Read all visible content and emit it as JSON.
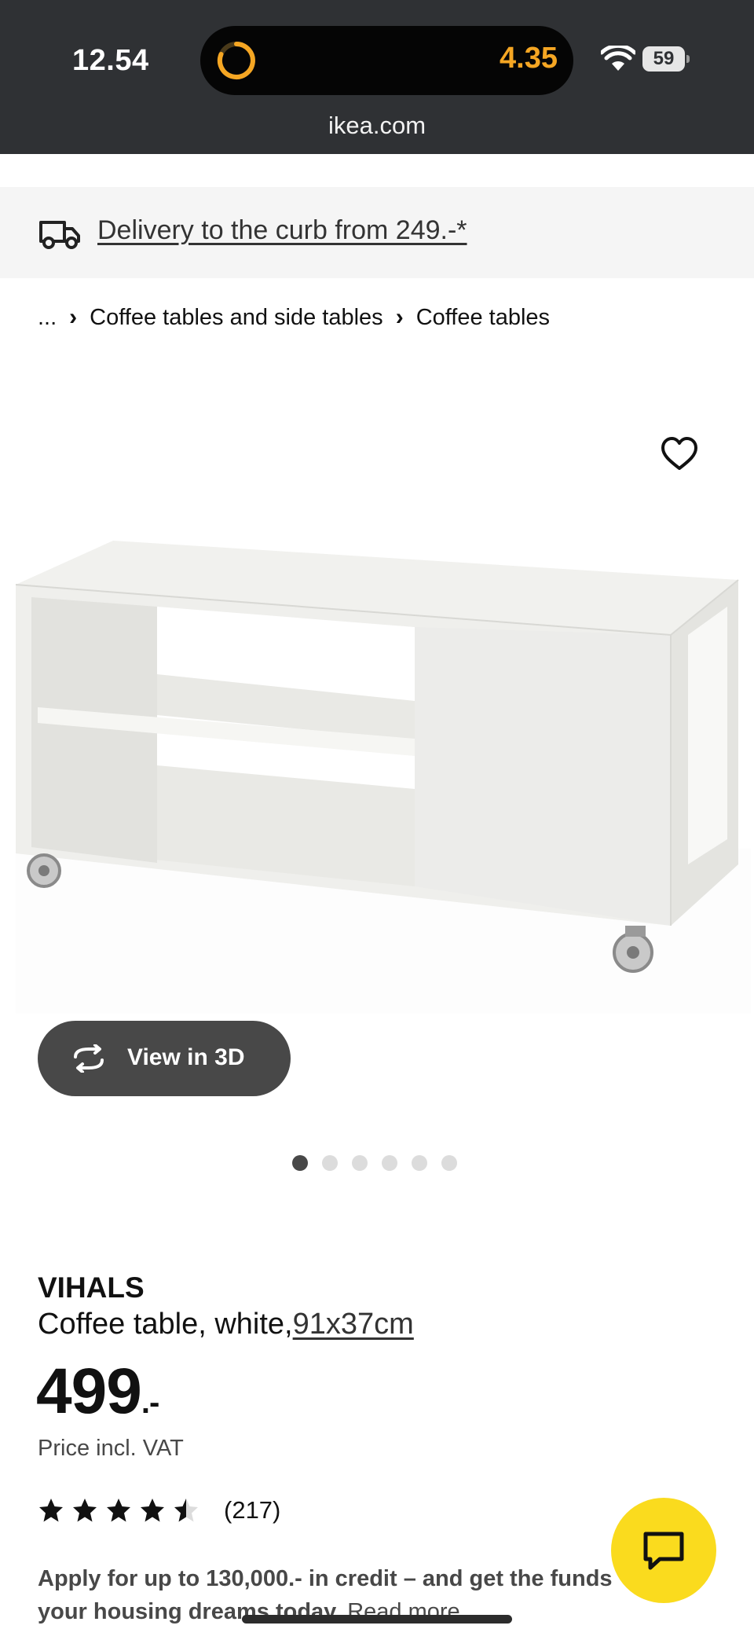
{
  "status_bar": {
    "time": "12.54",
    "island_time": "4.35",
    "battery": "59",
    "island_accent": "#f5a623"
  },
  "browser": {
    "url": "ikea.com"
  },
  "delivery_banner": {
    "text": "Delivery to the curb from 249.-*",
    "icon": "truck-icon"
  },
  "breadcrumb": {
    "items": [
      "...",
      "Coffee tables and side tables",
      "Coffee tables"
    ],
    "separator": "›"
  },
  "gallery": {
    "view_3d_label": "View in 3D",
    "dots_total": 6,
    "active_dot": 1
  },
  "product": {
    "name": "VIHALS",
    "description": "Coffee table, white,",
    "size": "91x37cm",
    "price": "499",
    "price_suffix": ".-",
    "vat_note": "Price incl. VAT",
    "rating": 4.5,
    "rating_max": 5,
    "review_count": "(217)"
  },
  "credit_promo": {
    "line1": "Apply for up to 130,000.- in credit – and get the funds",
    "line2": "your housing dreams today.",
    "read_more": "Read more"
  },
  "colors": {
    "brand_yellow": "#fadb1e",
    "dark_button": "#484848",
    "banner_bg": "#f5f5f5",
    "topbar_bg": "#2f3134"
  }
}
